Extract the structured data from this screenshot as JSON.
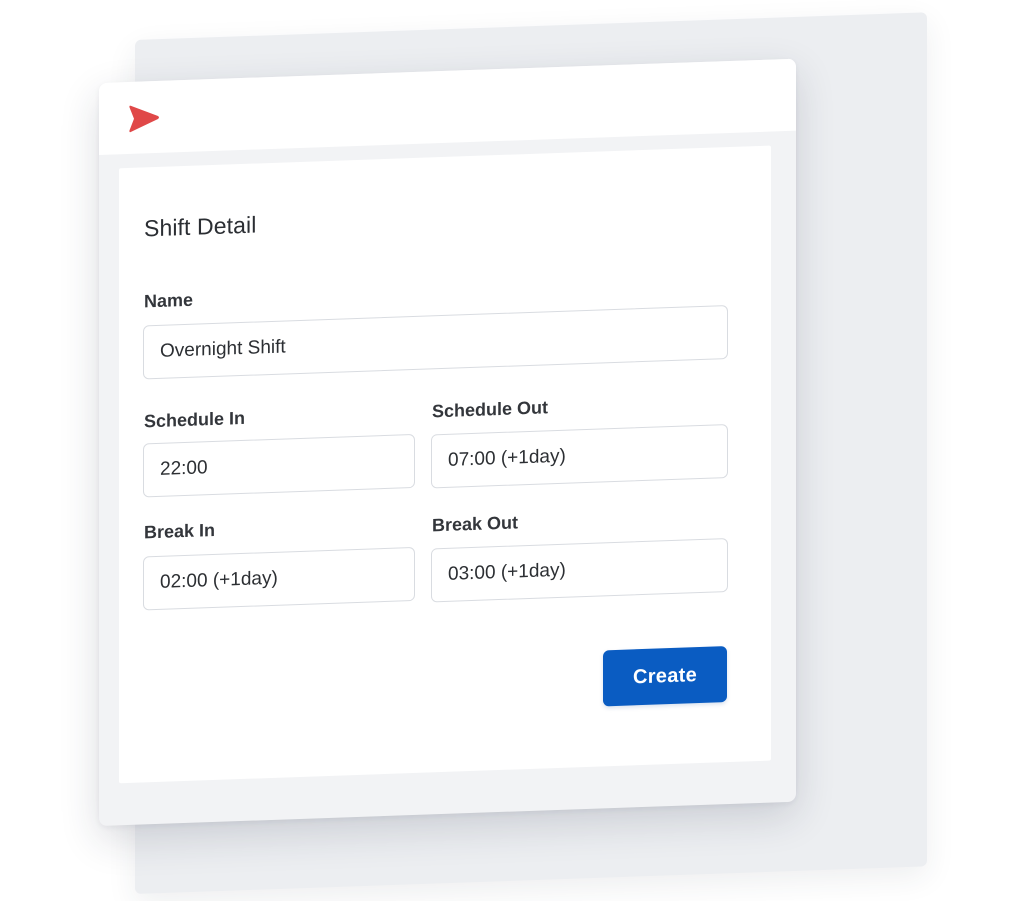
{
  "colors": {
    "accent": "#0a5cc2",
    "logo": "#e04848",
    "page_background": "#ffffff",
    "window_background": "#f2f3f5"
  },
  "header": {
    "logo_icon": "red-chevron-logo-icon"
  },
  "form": {
    "title": "Shift Detail",
    "name": {
      "label": "Name",
      "value": "Overnight Shift"
    },
    "schedule_in": {
      "label": "Schedule In",
      "value": "22:00"
    },
    "schedule_out": {
      "label": "Schedule Out",
      "value": "07:00 (+1day)"
    },
    "break_in": {
      "label": "Break In",
      "value": "02:00 (+1day)"
    },
    "break_out": {
      "label": "Break Out",
      "value": "03:00 (+1day)"
    },
    "create_label": "Create"
  }
}
